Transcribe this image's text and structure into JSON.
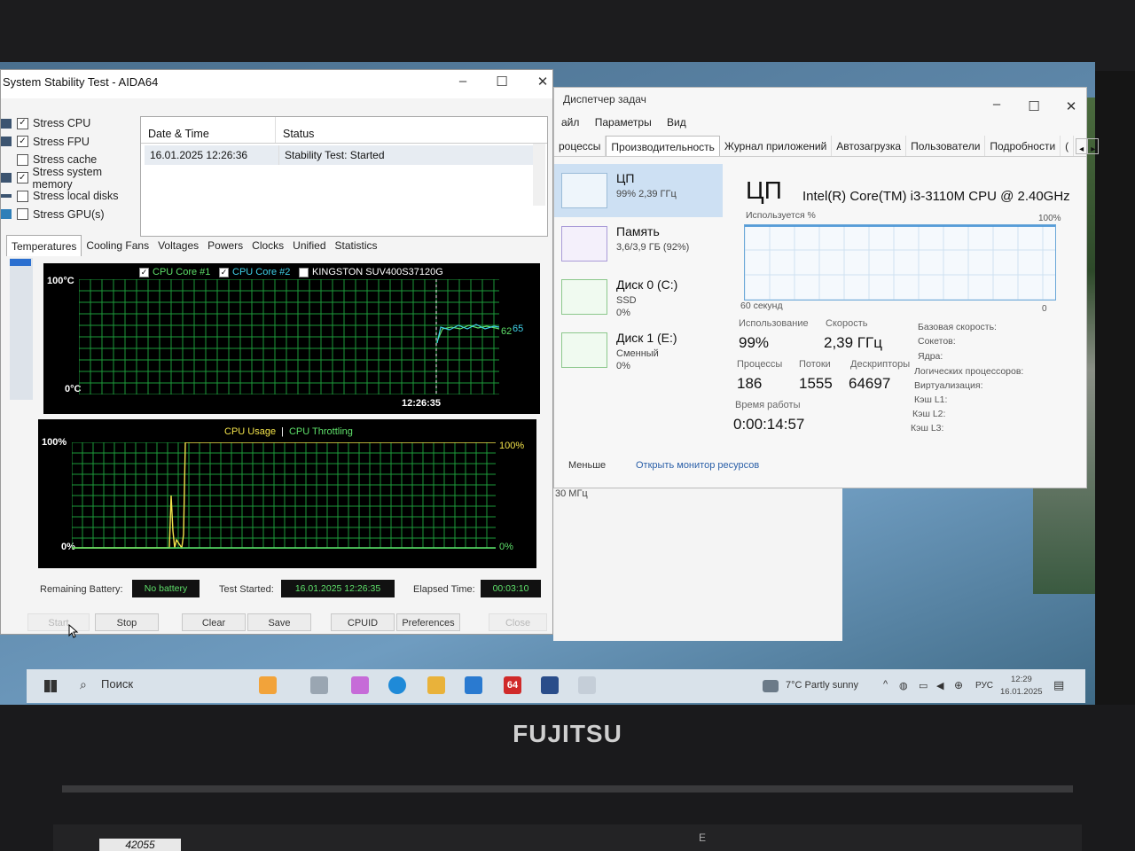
{
  "aida": {
    "title": "System Stability Test - AIDA64",
    "stress_items": [
      {
        "label": "Stress CPU",
        "checked": true
      },
      {
        "label": "Stress FPU",
        "checked": true
      },
      {
        "label": "Stress cache",
        "checked": false
      },
      {
        "label": "Stress system memory",
        "checked": true
      },
      {
        "label": "Stress local disks",
        "checked": false
      },
      {
        "label": "Stress GPU(s)",
        "checked": false
      }
    ],
    "status_table": {
      "headers": [
        "Date & Time",
        "Status"
      ],
      "rows": [
        [
          "16.01.2025 12:26:36",
          "Stability Test: Started"
        ]
      ]
    },
    "tabs": [
      "Temperatures",
      "Cooling Fans",
      "Voltages",
      "Powers",
      "Clocks",
      "Unified",
      "Statistics"
    ],
    "temp_graph": {
      "legend": [
        {
          "label": "CPU Core #1",
          "checked": true,
          "color": "#5ee06a"
        },
        {
          "label": "CPU Core #2",
          "checked": true,
          "color": "#3fd0e8"
        },
        {
          "label": "KINGSTON SUV400S37120G",
          "checked": false,
          "color": "#ffffff"
        }
      ],
      "y_max_label": "100°C",
      "y_min_label": "0°C",
      "time_label": "12:26:35",
      "end_values": [
        "62",
        "65"
      ]
    },
    "usage_graph": {
      "legend_left": "CPU Usage",
      "legend_sep": "|",
      "legend_right": "CPU Throttling",
      "y_left_max": "100%",
      "y_left_min": "0%",
      "y_right_max": "100%",
      "y_right_min": "0%"
    },
    "info": {
      "battery_label": "Remaining Battery:",
      "battery_value": "No battery",
      "test_started_label": "Test Started:",
      "test_started_value": "16.01.2025 12:26:35",
      "elapsed_label": "Elapsed Time:",
      "elapsed_value": "00:03:10"
    },
    "buttons": {
      "start": "Start",
      "stop": "Stop",
      "clear": "Clear",
      "save": "Save",
      "cpuid": "CPUID",
      "preferences": "Preferences",
      "close": "Close"
    }
  },
  "taskmgr": {
    "title": "Диспетчер задач",
    "menu": [
      "айл",
      "Параметры",
      "Вид"
    ],
    "tabs": [
      "роцессы",
      "Производительность",
      "Журнал приложений",
      "Автозагрузка",
      "Пользователи",
      "Подробности",
      "("
    ],
    "resources": [
      {
        "name": "ЦП",
        "sub1": "99% 2,39 ГГц",
        "sub2": ""
      },
      {
        "name": "Память",
        "sub1": "3,6/3,9 ГБ (92%)",
        "sub2": ""
      },
      {
        "name": "Диск 0 (C:)",
        "sub1": "SSD",
        "sub2": "0%"
      },
      {
        "name": "Диск 1 (E:)",
        "sub1": "Сменный",
        "sub2": "0%"
      }
    ],
    "cpu": {
      "heading": "ЦП",
      "model": "Intel(R) Core(TM) i3-3110M CPU @ 2.40GHz",
      "usage_label": "Используется %",
      "max_label": "100%",
      "window_label": "60 секунд",
      "zero_label": "0",
      "stats": {
        "util_label": "Использование",
        "util_value": "99%",
        "speed_label": "Скорость",
        "speed_value": "2,39 ГГц",
        "proc_label": "Процессы",
        "proc_value": "186",
        "threads_label": "Потоки",
        "threads_value": "1555",
        "handles_label": "Дескрипторы",
        "handles_value": "64697",
        "uptime_label": "Время работы",
        "uptime_value": "0:00:14:57"
      },
      "specs": [
        "Базовая скорость:",
        "Сокетов:",
        "Ядра:",
        "Логических процессоров:",
        "Виртуализация:",
        "Кэш L1:",
        "Кэш L2:",
        "Кэш L3:"
      ]
    },
    "footer": {
      "less": "Меньше",
      "monitor": "Открыть монитор ресурсов"
    }
  },
  "behind": {
    "text": "30 МГц"
  },
  "taskbar": {
    "search": "Поиск",
    "weather": "7°C  Partly sunny",
    "lang": "РУС",
    "time": "12:29",
    "date": "16.01.2025",
    "aida_badge": "64"
  },
  "laptop": {
    "brand": "FUJITSU",
    "sticker": "42055"
  },
  "keyboard": {
    "e_key": "E"
  }
}
